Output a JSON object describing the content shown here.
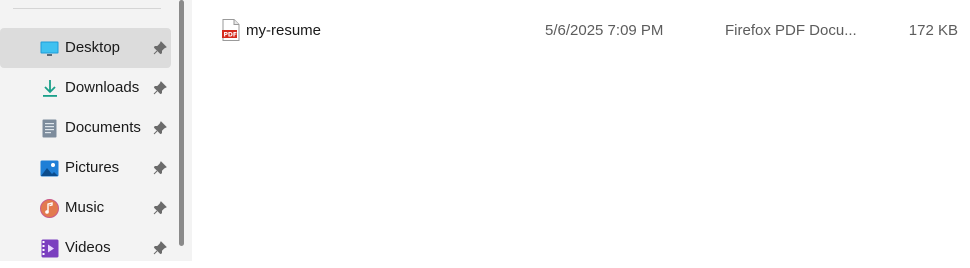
{
  "sidebar": {
    "items": [
      {
        "label": "Desktop",
        "icon": "desktop-icon",
        "selected": true
      },
      {
        "label": "Downloads",
        "icon": "downloads-icon"
      },
      {
        "label": "Documents",
        "icon": "documents-icon"
      },
      {
        "label": "Pictures",
        "icon": "pictures-icon"
      },
      {
        "label": "Music",
        "icon": "music-icon"
      },
      {
        "label": "Videos",
        "icon": "videos-icon"
      }
    ]
  },
  "files": {
    "rows": [
      {
        "name": "my-resume",
        "date_modified": "5/6/2025 7:09 PM",
        "type": "Firefox PDF Docu...",
        "size": "172 KB",
        "icon": "pdf-icon"
      }
    ]
  },
  "colors": {
    "selected_bg": "#dcdcdc",
    "sidebar_bg": "#f3f3f3",
    "pdf_red": "#d52b1e"
  }
}
